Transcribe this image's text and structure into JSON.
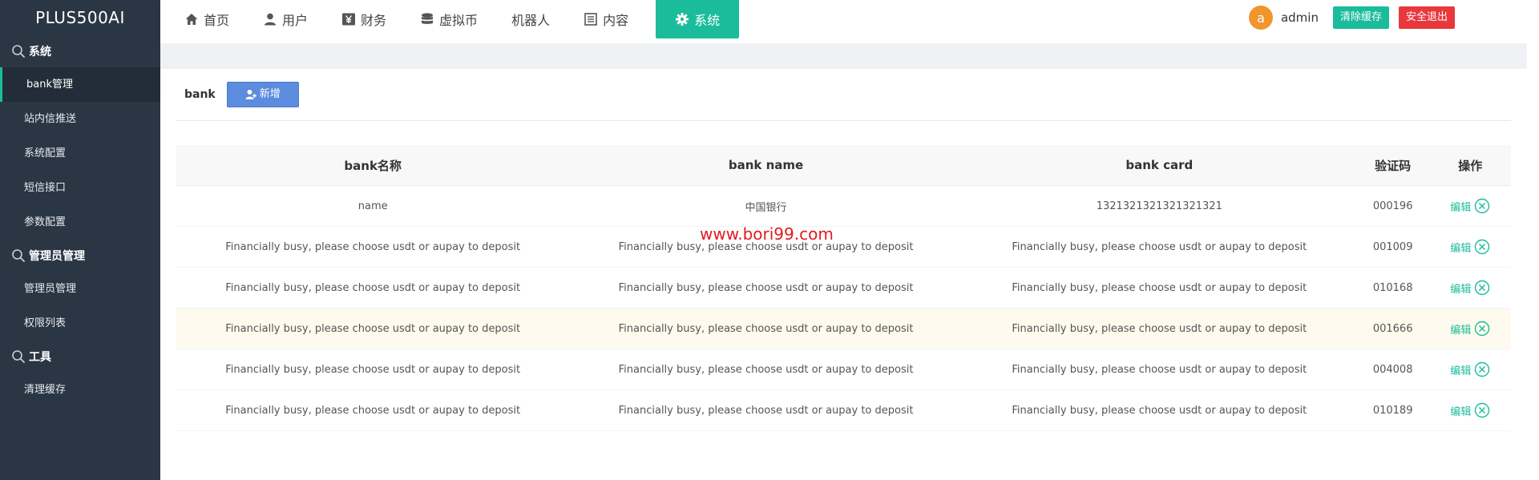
{
  "brand": "PLUS500AI",
  "sidebar": {
    "groups": [
      {
        "title": "系统",
        "icon": "search-icon",
        "items": [
          "bank管理",
          "站内信推送",
          "系统配置",
          "短信接口",
          "参数配置"
        ]
      },
      {
        "title": "管理员管理",
        "icon": "search-icon",
        "items": [
          "管理员管理",
          "权限列表"
        ]
      },
      {
        "title": "工具",
        "icon": "search-icon",
        "items": [
          "清理缓存"
        ]
      }
    ],
    "active_item": "bank管理"
  },
  "topnav": {
    "items": [
      {
        "label": "首页",
        "icon": "home-icon"
      },
      {
        "label": "用户",
        "icon": "user-icon"
      },
      {
        "label": "财务",
        "icon": "yen-icon"
      },
      {
        "label": "虚拟币",
        "icon": "database-icon"
      },
      {
        "label": "机器人",
        "icon": ""
      },
      {
        "label": "内容",
        "icon": "list-icon"
      },
      {
        "label": "系统",
        "icon": "gear-icon"
      }
    ],
    "active": "系统"
  },
  "user": {
    "avatar_letter": "a",
    "name": "admin",
    "clear_cache_label": "清除缓存",
    "logout_label": "安全退出"
  },
  "toolbar": {
    "label": "bank",
    "add_label": "新增"
  },
  "table": {
    "headers": [
      "bank名称",
      "bank name",
      "bank card",
      "验证码",
      "操作"
    ],
    "rows": [
      [
        "name",
        "中国银行",
        "1321321321321321321",
        "000196"
      ],
      [
        "Financially busy, please choose usdt or aupay to deposit",
        "Financially busy, please choose usdt or aupay to deposit",
        "Financially busy, please choose usdt or aupay to deposit",
        "001009"
      ],
      [
        "Financially busy, please choose usdt or aupay to deposit",
        "Financially busy, please choose usdt or aupay to deposit",
        "Financially busy, please choose usdt or aupay to deposit",
        "010168"
      ],
      [
        "Financially busy, please choose usdt or aupay to deposit",
        "Financially busy, please choose usdt or aupay to deposit",
        "Financially busy, please choose usdt or aupay to deposit",
        "001666"
      ],
      [
        "Financially busy, please choose usdt or aupay to deposit",
        "Financially busy, please choose usdt or aupay to deposit",
        "Financially busy, please choose usdt or aupay to deposit",
        "004008"
      ],
      [
        "Financially busy, please choose usdt or aupay to deposit",
        "Financially busy, please choose usdt or aupay to deposit",
        "Financially busy, please choose usdt or aupay to deposit",
        "010189"
      ]
    ],
    "highlighted_row": 3,
    "edit_label": "编辑"
  },
  "watermark": "www.bori99.com",
  "colors": {
    "accent": "#1abc9c",
    "danger": "#e8383d",
    "sidebar_bg": "#2b3645",
    "add_button": "#5b8cdd",
    "avatar": "#f0962c"
  }
}
